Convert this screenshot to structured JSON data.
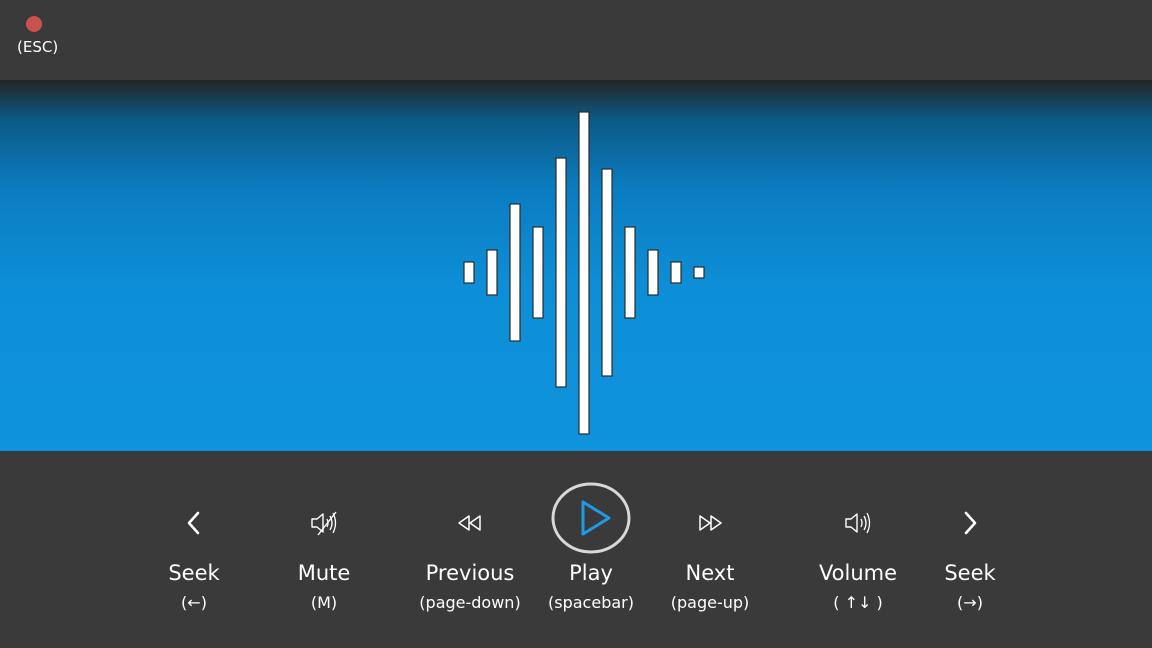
{
  "top": {
    "esc_label": "(ESC)"
  },
  "visual": {
    "icon": "sound-wave-icon"
  },
  "controls": [
    {
      "id": "seek-back",
      "label": "Seek",
      "key": "(←)",
      "icon": "chevron-left-icon"
    },
    {
      "id": "mute",
      "label": "Mute",
      "key": "(M)",
      "icon": "speaker-muted-icon"
    },
    {
      "id": "previous",
      "label": "Previous",
      "key": "(page-down)",
      "icon": "rewind-icon"
    },
    {
      "id": "play",
      "label": "Play",
      "key": "(spacebar)",
      "icon": "play-icon"
    },
    {
      "id": "next",
      "label": "Next",
      "key": "(page-up)",
      "icon": "fast-forward-icon"
    },
    {
      "id": "volume",
      "label": "Volume",
      "key": "( ↑↓ )",
      "icon": "speaker-volume-icon"
    },
    {
      "id": "seek-forward",
      "label": "Seek",
      "key": "(→)",
      "icon": "chevron-right-icon"
    }
  ],
  "colors": {
    "esc_dot": "#c9524e",
    "play_accent": "#1e9be8",
    "panel": "#3a3a3a"
  }
}
